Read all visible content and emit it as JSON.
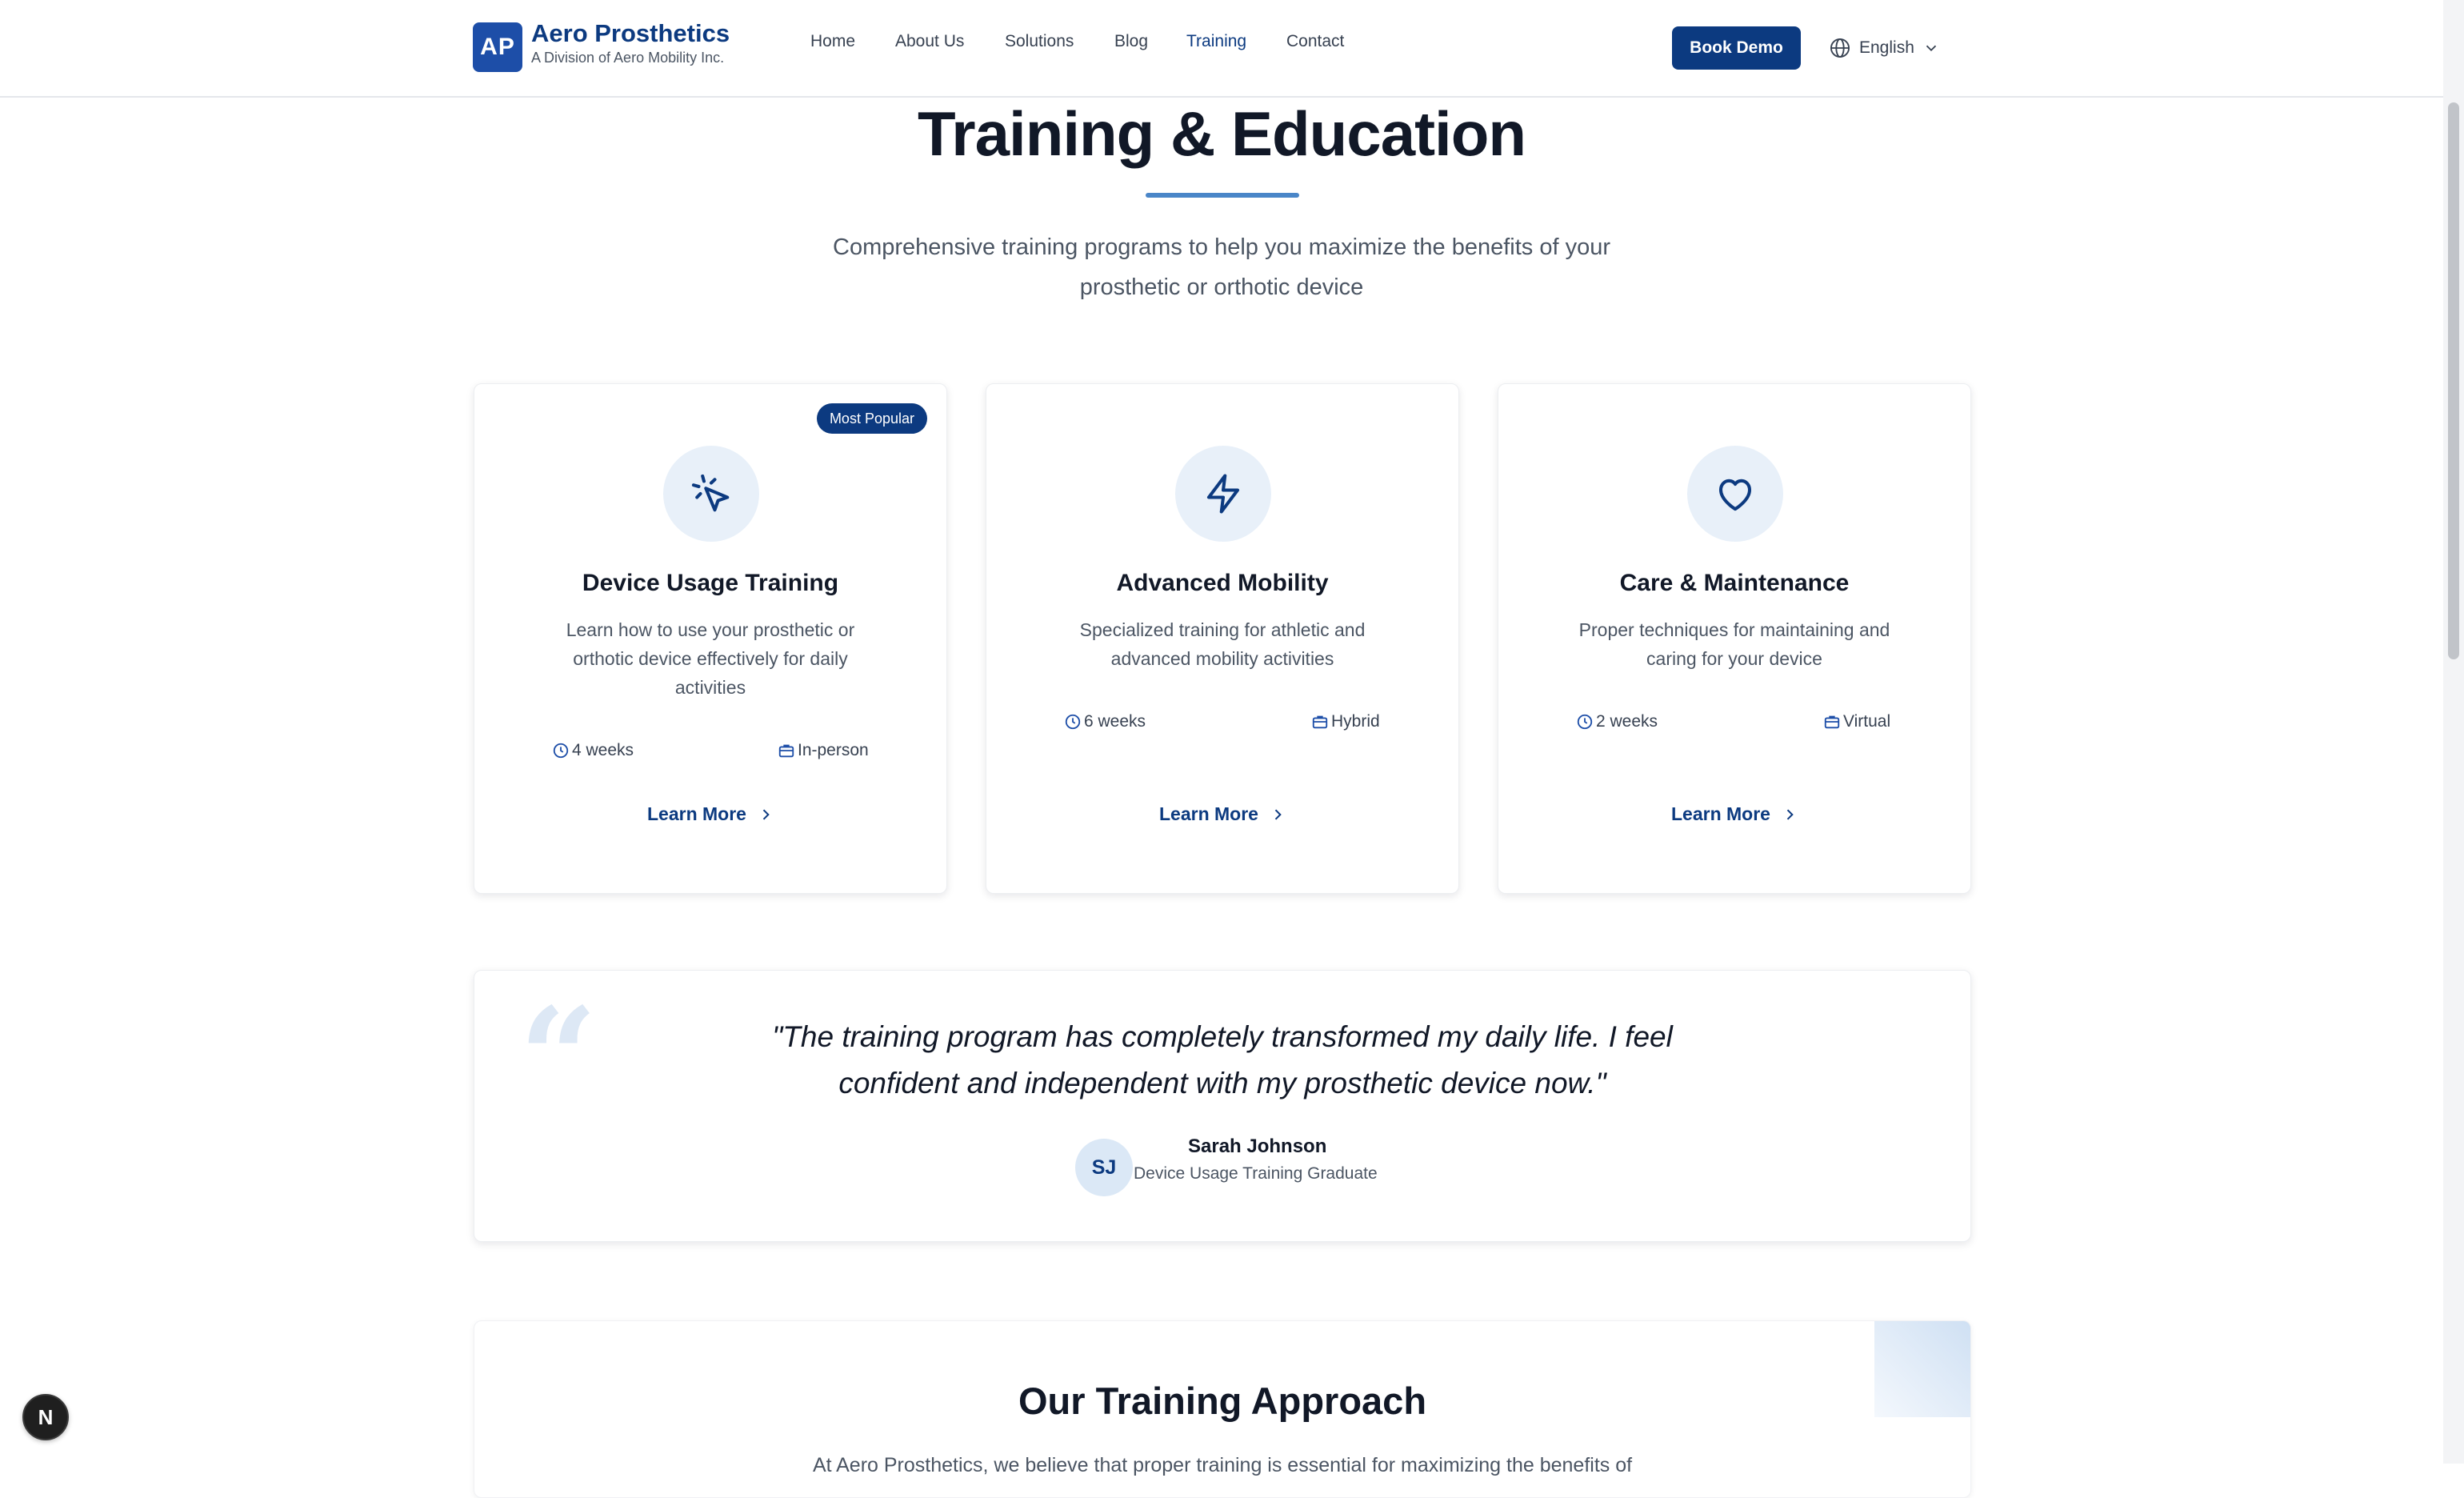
{
  "header": {
    "logo_text": "AP",
    "brand_name": "Aero Prosthetics",
    "brand_sub": "A Division of Aero Mobility Inc.",
    "nav": [
      "Home",
      "About Us",
      "Solutions",
      "Blog",
      "Training",
      "Contact"
    ],
    "active_nav": "Training",
    "book_demo": "Book Demo",
    "language": "English"
  },
  "hero": {
    "title": "Training & Education",
    "subtitle": "Comprehensive training programs to help you maximize the benefits of your prosthetic or orthotic device"
  },
  "cards": [
    {
      "badge": "Most Popular",
      "icon": "cursor-click-icon",
      "title": "Device Usage Training",
      "description": "Learn how to use your prosthetic or orthotic device effectively for daily activities",
      "duration": "4 weeks",
      "format": "In-person",
      "cta": "Learn More"
    },
    {
      "icon": "lightning-icon",
      "title": "Advanced Mobility",
      "description": "Specialized training for athletic and advanced mobility activities",
      "duration": "6 weeks",
      "format": "Hybrid",
      "cta": "Learn More"
    },
    {
      "icon": "heart-icon",
      "title": "Care & Maintenance",
      "description": "Proper techniques for maintaining and caring for your device",
      "duration": "2 weeks",
      "format": "Virtual",
      "cta": "Learn More"
    }
  ],
  "testimonial": {
    "quote": "\"The training program has completely transformed my daily life. I feel confident and independent with my prosthetic device now.\"",
    "initials": "SJ",
    "name": "Sarah Johnson",
    "role": "Device Usage Training Graduate"
  },
  "approach": {
    "title": "Our Training Approach",
    "text": "At Aero Prosthetics, we believe that proper training is essential for maximizing the benefits of"
  },
  "fab": {
    "label": "N"
  },
  "colors": {
    "primary": "#0c3a80",
    "accent": "#4a86c8",
    "icon_bg": "#e8f0f9"
  }
}
